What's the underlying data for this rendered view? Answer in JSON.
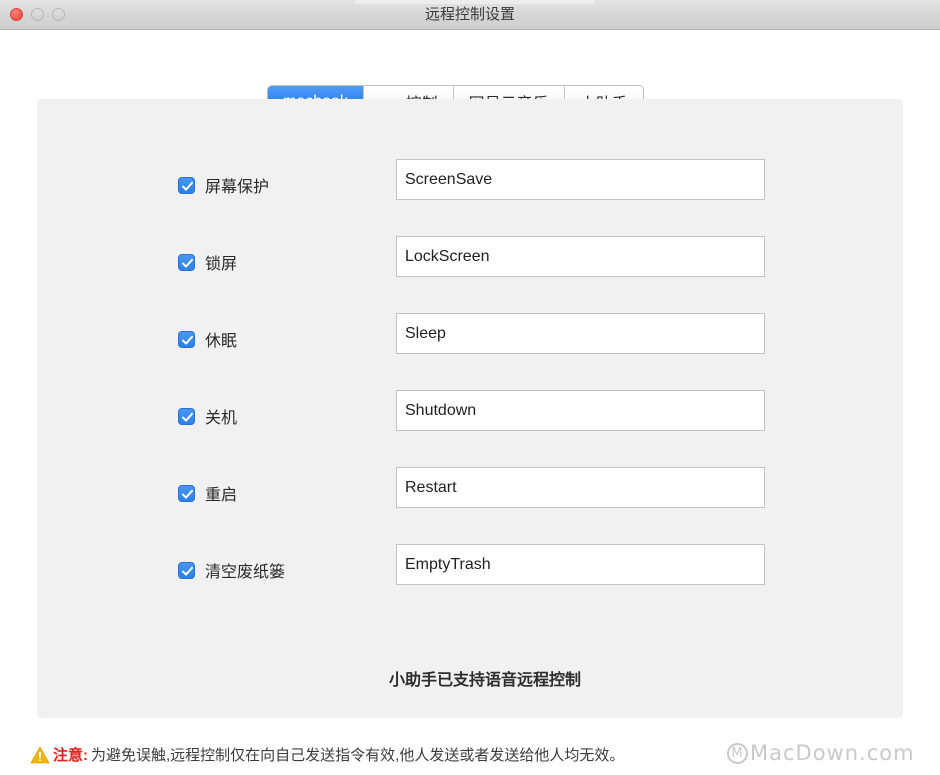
{
  "window": {
    "title": "远程控制设置",
    "controls": [
      {
        "name": "close",
        "color": "#f4544a"
      },
      {
        "name": "minimize",
        "color": "#cfcfcf"
      },
      {
        "name": "maximize",
        "color": "#cfcfcf"
      }
    ]
  },
  "tabs": [
    {
      "label": "macbook",
      "active": true
    },
    {
      "label": "app控制",
      "active": false
    },
    {
      "label": "网易云音乐",
      "active": false
    },
    {
      "label": "小助手",
      "active": false
    }
  ],
  "settings": {
    "rows": [
      {
        "label": "屏幕保护",
        "checked": true,
        "command": "ScreenSave"
      },
      {
        "label": "锁屏",
        "checked": true,
        "command": "LockScreen"
      },
      {
        "label": "休眠",
        "checked": true,
        "command": "Sleep"
      },
      {
        "label": "关机",
        "checked": true,
        "command": "Shutdown"
      },
      {
        "label": "重启",
        "checked": true,
        "command": "Restart"
      },
      {
        "label": "清空废纸篓",
        "checked": true,
        "command": "EmptyTrash"
      }
    ],
    "footer_note": "小助手已支持语音远程控制"
  },
  "warning": {
    "icon": "warning-triangle-icon",
    "label": "注意:",
    "text": "为避免误触,远程控制仅在向自己发送指令有效,他人发送或者发送给他人均无效。"
  },
  "watermark": {
    "logo": "M",
    "text": "MacDown.com"
  },
  "colors": {
    "accent": "#2a81ef",
    "panel": "#f1f1f1",
    "warning_red": "#e8201c",
    "warning_yellow": "#f5b301"
  }
}
